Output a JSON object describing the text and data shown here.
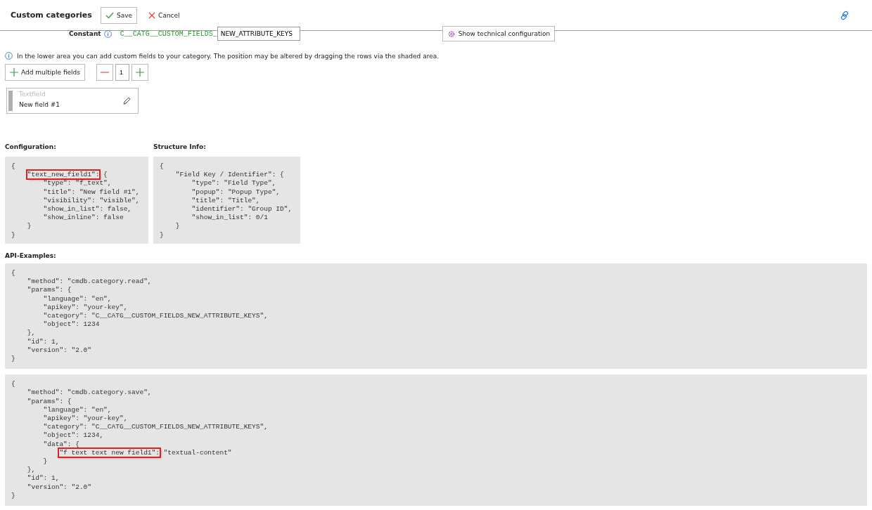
{
  "header": {
    "title": "Custom categories",
    "save": "Save",
    "cancel": "Cancel"
  },
  "constant": {
    "label": "Constant",
    "prefix": "C__CATG__CUSTOM_FIELDS_",
    "value": "NEW_ATTRIBUTE_KEYS",
    "tech_button": "Show technical configuration"
  },
  "info": "In the lower area you can add custom fields to your category. The position may be altered by dragging the rows via the shaded area.",
  "add_button": "Add multiple fields",
  "count": "1",
  "fields": [
    {
      "type": "Textfield",
      "title": "New field #1"
    }
  ],
  "configuration": {
    "label": "Configuration:",
    "lines": [
      "{",
      {
        "mark": "\"text_new_field1\":",
        "after": " {"
      },
      "        \"type\": \"f_text\",",
      "        \"title\": \"New field #1\",",
      "        \"visibility\": \"visible\",",
      "        \"show_in_list\": false,",
      "        \"show_inline\": false",
      "    }",
      "}"
    ]
  },
  "structure": {
    "label": "Structure Info:",
    "lines": [
      "{",
      "    \"Field Key / Identifier\": {",
      "        \"type\": \"Field Type\",",
      "        \"popup\": \"Popup Type\",",
      "        \"title\": \"Title\",",
      "        \"identifier\": \"Group ID\",",
      "        \"show_in_list\": 0/1",
      "    }",
      "}"
    ]
  },
  "api": {
    "label": "API-Examples:",
    "examples": [
      {
        "lines": [
          "{",
          "    \"method\": \"cmdb.category.read\",",
          "    \"params\": {",
          "        \"language\": \"en\",",
          "        \"apikey\": \"your-key\",",
          "        \"category\": \"C__CATG__CUSTOM_FIELDS_NEW_ATTRIBUTE_KEYS\",",
          "        \"object\": 1234",
          "    },",
          "    \"id\": 1,",
          "    \"version\": \"2.0\"",
          "}"
        ]
      },
      {
        "lines": [
          "{",
          "    \"method\": \"cmdb.category.save\",",
          "    \"params\": {",
          "        \"language\": \"en\",",
          "        \"apikey\": \"your-key\",",
          "        \"category\": \"C__CATG__CUSTOM_FIELDS_NEW_ATTRIBUTE_KEYS\",",
          "        \"object\": 1234,",
          "        \"data\": {",
          {
            "mark": "\"f text text new field1\":",
            "after": " \"textual-content\""
          },
          "        }",
          "    },",
          "    \"id\": 1,",
          "    \"version\": \"2.0\"",
          "}"
        ]
      }
    ]
  }
}
